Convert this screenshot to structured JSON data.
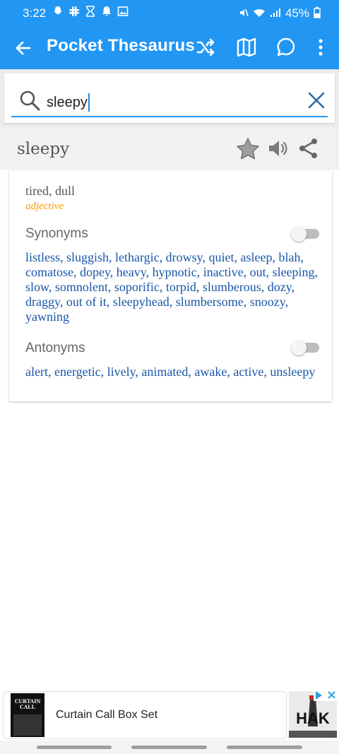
{
  "status_bar": {
    "time": "3:22",
    "battery": "45%",
    "left_icons": [
      "snapchat-icon",
      "slack-icon",
      "hourglass-icon",
      "bell-icon",
      "image-icon"
    ],
    "right_icons": [
      "mute-icon",
      "wifi-icon",
      "signal-icon",
      "battery-icon"
    ]
  },
  "app_bar": {
    "title": "Pocket Thesaurus",
    "actions": [
      "shuffle-icon",
      "map-icon",
      "chat-icon",
      "more-vert-icon"
    ]
  },
  "search": {
    "value": "sleepy",
    "placeholder": ""
  },
  "entry": {
    "word": "sleepy",
    "actions": [
      "star-icon",
      "speaker-icon",
      "share-icon"
    ],
    "sense": "tired, dull",
    "part_of_speech": "adjective",
    "synonyms_label": "Synonyms",
    "synonyms_toggle_on": false,
    "synonyms": "listless, sluggish, lethargic, drowsy, quiet, asleep, blah, comatose, dopey, heavy, hypnotic, inactive, out, sleeping, slow, somnolent, soporific, torpid, slumberous, dozy, draggy, out of it, sleepyhead, slumbersome, snoozy, yawning",
    "antonyms_label": "Antonyms",
    "antonyms_toggle_on": false,
    "antonyms": "alert, energetic, lively, animated, awake, active, unsleepy"
  },
  "ad": {
    "title": "Curtain Call Box Set",
    "thumb_text": "CURTAIN CALL",
    "logo_text": "HAK"
  },
  "colors": {
    "primary": "#2196f3",
    "link": "#1a56a8",
    "pos": "#ff9800"
  }
}
